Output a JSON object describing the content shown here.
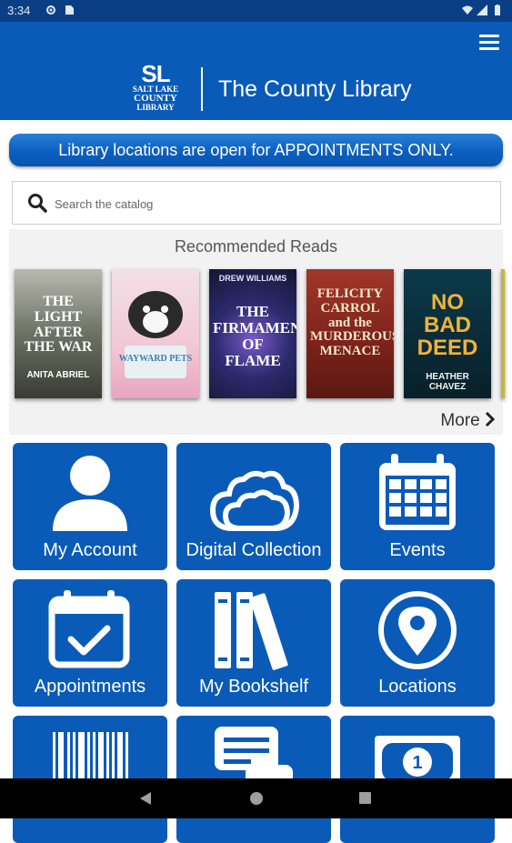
{
  "status_bar": {
    "time": "3:34"
  },
  "header": {
    "brand_name": "The County Library",
    "logo_text": [
      "SALT LAKE",
      "COUNTY",
      "LIBRARY"
    ],
    "logo_mark": "SL"
  },
  "banner": {
    "text": "Library locations are open for APPOINTMENTS ONLY."
  },
  "search": {
    "placeholder": "Search the catalog"
  },
  "recommended": {
    "title": "Recommended Reads",
    "more_label": "More",
    "books": [
      {
        "title": "THE LIGHT AFTER THE WAR",
        "author": "ANITA ABRIEL"
      },
      {
        "title": "WAYWARD PETS",
        "author": ""
      },
      {
        "title": "THE FIRMAMENT OF FLAME",
        "author": "DREW WILLIAMS"
      },
      {
        "title": "FELICITY CARROL and the MURDEROUS MENACE",
        "author": ""
      },
      {
        "title": "NO BAD DEED",
        "author": "HEATHER CHAVEZ"
      }
    ]
  },
  "tiles": [
    {
      "label": "My Account",
      "icon": "person-icon"
    },
    {
      "label": "Digital Collection",
      "icon": "cloud-icon"
    },
    {
      "label": "Events",
      "icon": "calendar-icon"
    },
    {
      "label": "Appointments",
      "icon": "calendar-check-icon"
    },
    {
      "label": "My Bookshelf",
      "icon": "books-icon"
    },
    {
      "label": "Locations",
      "icon": "map-pin-icon"
    },
    {
      "label": "",
      "icon": "barcode-icon"
    },
    {
      "label": "",
      "icon": "chat-icon"
    },
    {
      "label": "",
      "icon": "money-icon"
    }
  ],
  "colors": {
    "brand_blue": "#0a5bb8",
    "header_dark": "#0a3f86"
  }
}
